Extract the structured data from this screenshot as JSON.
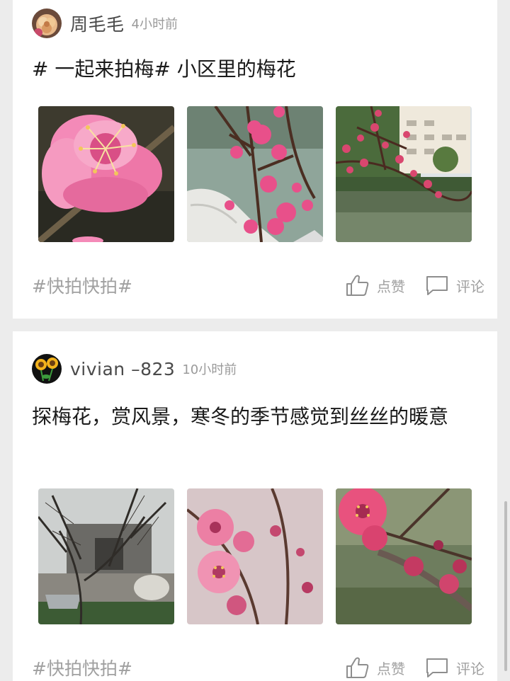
{
  "posts": [
    {
      "author": "周毛毛",
      "time": "4小时前",
      "text": "# 一起来拍梅# 小区里的梅花",
      "tag": "#快拍快拍#",
      "like_label": "点赞",
      "comment_label": "评论"
    },
    {
      "author": "vivian –823",
      "time": "10小时前",
      "text": "探梅花，赏风景，寒冬的季节感觉到丝丝的暖意",
      "tag": "#快拍快拍#",
      "like_label": "点赞",
      "comment_label": "评论"
    }
  ],
  "icons": {
    "like": "thumbs-up-icon",
    "comment": "comment-bubble-icon"
  },
  "colors": {
    "background": "#ececec",
    "card": "#ffffff",
    "muted_text": "#a0a0a0",
    "blossom_pink": "#e8508a"
  }
}
